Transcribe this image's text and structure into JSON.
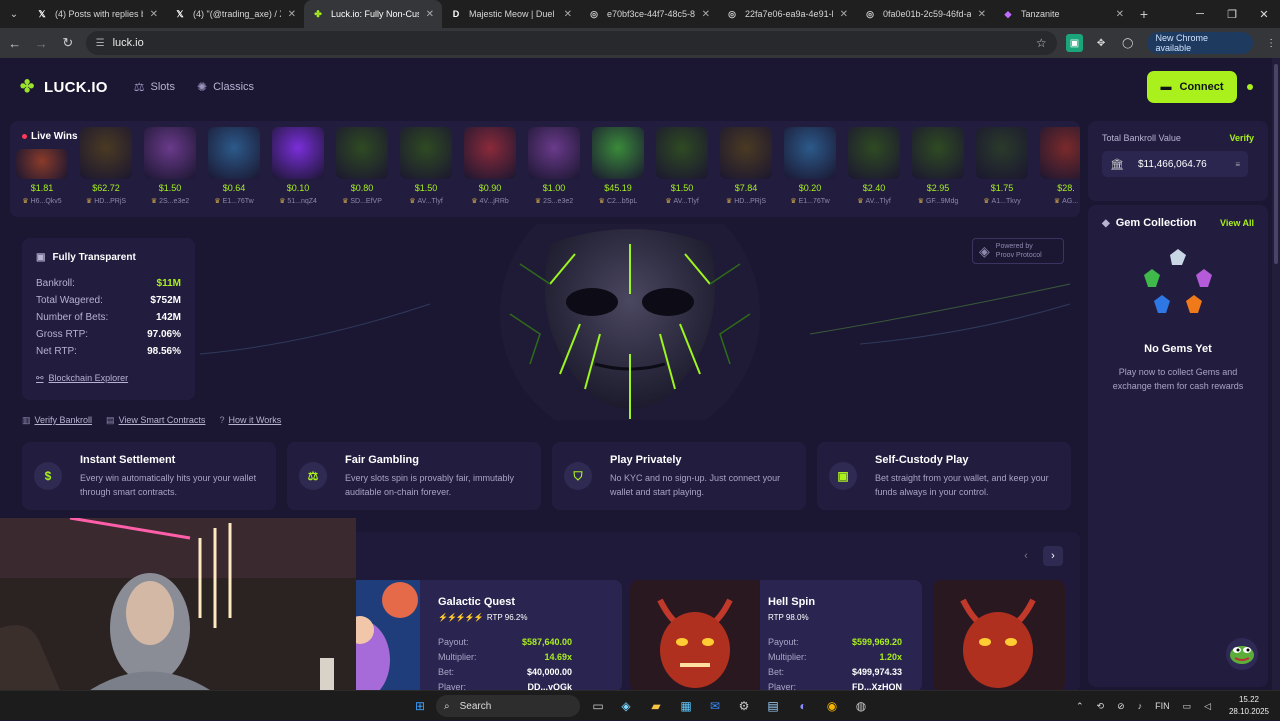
{
  "browser": {
    "tabs": [
      {
        "title": "(4) Posts with replies by g",
        "icon": "x-icon"
      },
      {
        "title": "(4) \"(@trading_axe) / X",
        "icon": "x-icon"
      },
      {
        "title": "Luck.io: Fully Non-Custod",
        "icon": "luck-clover-icon",
        "active": true
      },
      {
        "title": "Majestic Meow | Duel",
        "icon": "duel-d-icon"
      },
      {
        "title": "e70bf3ce-44f7-48c5-8778",
        "icon": "globe-icon"
      },
      {
        "title": "22fa7e06-ea9a-4e91-bee",
        "icon": "globe-icon"
      },
      {
        "title": "0fa0e01b-2c59-46fd-ae0",
        "icon": "globe-icon"
      },
      {
        "title": "Tanzanite",
        "icon": "tanzanite-icon"
      }
    ],
    "url": "luck.io",
    "new_chrome": "New Chrome available"
  },
  "header": {
    "logo": "LUCK.IO",
    "nav": [
      {
        "label": "Slots",
        "icon": "slots-icon"
      },
      {
        "label": "Classics",
        "icon": "classics-icon"
      }
    ],
    "connect": "Connect"
  },
  "live_wins": {
    "title": "Live Wins",
    "items": [
      {
        "amount": "$1.81",
        "user": "H6...Qkv5"
      },
      {
        "amount": "$62.72",
        "user": "HD...PRjS"
      },
      {
        "amount": "$1.50",
        "user": "2S...e3e2"
      },
      {
        "amount": "$0.64",
        "user": "E1...76Tw"
      },
      {
        "amount": "$0.10",
        "user": "51...nqZ4"
      },
      {
        "amount": "$0.80",
        "user": "SD...EfVP"
      },
      {
        "amount": "$1.50",
        "user": "AV...Tlyf"
      },
      {
        "amount": "$0.90",
        "user": "4V...jRRb"
      },
      {
        "amount": "$1.00",
        "user": "2S...e3e2"
      },
      {
        "amount": "$45.19",
        "user": "C2...b5pL"
      },
      {
        "amount": "$1.50",
        "user": "AV...Tlyf"
      },
      {
        "amount": "$7.84",
        "user": "HD...PRjS"
      },
      {
        "amount": "$0.20",
        "user": "E1...76Tw"
      },
      {
        "amount": "$2.40",
        "user": "AV...Tlyf"
      },
      {
        "amount": "$2.95",
        "user": "GF...9Mdg"
      },
      {
        "amount": "$1.75",
        "user": "A1...Tkvy"
      },
      {
        "amount": "$28.",
        "user": "AG..."
      }
    ]
  },
  "bankroll": {
    "label": "Total Bankroll Value",
    "verify": "Verify",
    "value": "$11,466,064.76"
  },
  "gems": {
    "title": "Gem Collection",
    "view_all": "View All",
    "empty_title": "No Gems Yet",
    "empty_desc": "Play now to collect Gems and exchange them for cash rewards"
  },
  "transparency": {
    "title": "Fully Transparent",
    "rows": [
      {
        "k": "Bankroll:",
        "v": "$11M"
      },
      {
        "k": "Total Wagered:",
        "v": "$752M"
      },
      {
        "k": "Number of Bets:",
        "v": "142M"
      },
      {
        "k": "Gross RTP:",
        "v": "97.06%"
      },
      {
        "k": "Net RTP:",
        "v": "98.56%"
      }
    ],
    "explorer": "Blockchain Explorer"
  },
  "proov": {
    "line1": "Powered by",
    "line2": "Proov Protocol"
  },
  "links": [
    "Verify Bankroll",
    "View Smart Contracts",
    "How it Works"
  ],
  "features": [
    {
      "title": "Instant Settlement",
      "desc": "Every win automatically hits your your wallet through smart contracts.",
      "icon": "dollar-icon"
    },
    {
      "title": "Fair Gambling",
      "desc": "Every slots spin is provably fair, immutably auditable on-chain forever.",
      "icon": "scales-icon"
    },
    {
      "title": "Play Privately",
      "desc": "No KYC and no sign-up. Just connect your wallet and start playing.",
      "icon": "shield-icon"
    },
    {
      "title": "Self-Custody Play",
      "desc": "Bet straight from your wallet, and keep your funds always in your control.",
      "icon": "wallet-icon"
    }
  ],
  "games": [
    {
      "name": "Galactic Quest",
      "rtp": "RTP 96.2%",
      "payout_k": "Payout:",
      "payout": "$587,640.00",
      "mult_k": "Multiplier:",
      "mult": "14.69x",
      "bet_k": "Bet:",
      "bet": "$40,000.00",
      "player_k": "Player:",
      "player": "DD...yQGk"
    },
    {
      "name": "Hell Spin",
      "rtp": "RTP 98.0%",
      "payout_k": "Payout:",
      "payout": "$599,969.20",
      "mult_k": "Multiplier:",
      "mult": "1.20x",
      "bet_k": "Bet:",
      "bet": "$499,974.33",
      "player_k": "Player:",
      "player": "FD...XzHQN"
    }
  ],
  "taskbar": {
    "search": "Search",
    "lang": "FIN",
    "time": "15.22",
    "date": "28.10.2025"
  },
  "colors": {
    "accent": "#a9f01c",
    "bg": "#1b1733",
    "card": "#221d3f"
  }
}
